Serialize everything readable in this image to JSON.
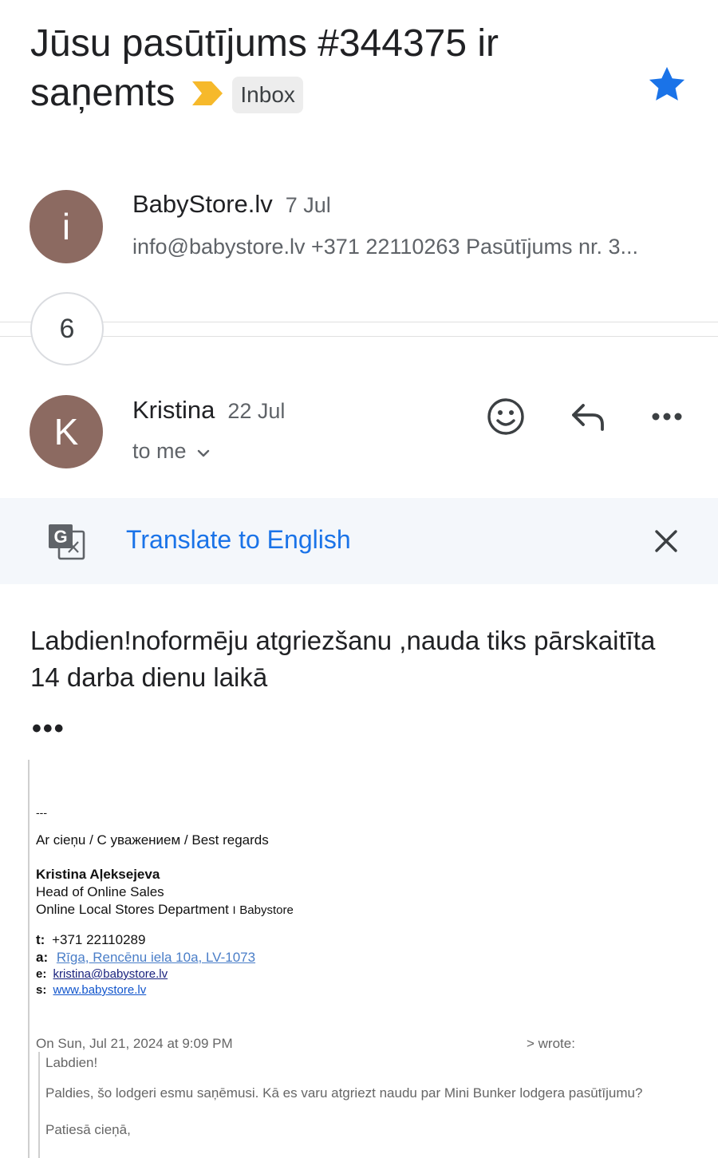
{
  "subject": {
    "text": "Jūsu pasūtījums #344375 ir saņemts",
    "label": "Inbox"
  },
  "colors": {
    "avatar": "#8c6a61",
    "star": "#1a73e8",
    "label_marker": "#f6b92b",
    "link": "#1a73e8",
    "translate_bg": "#f4f7fb"
  },
  "collapsed_message": {
    "avatar_letter": "i",
    "sender": "BabyStore.lv",
    "date": "7 Jul",
    "snippet": "info@babystore.lv +371 22110263 Pasūtījums nr. 3..."
  },
  "hidden_count": "6",
  "open_message": {
    "avatar_letter": "K",
    "sender": "Kristina",
    "date": "22 Jul",
    "recipient": "to me",
    "icons": [
      "emoji-icon",
      "reply-icon",
      "more-icon"
    ]
  },
  "translate": {
    "label": "Translate to English"
  },
  "body": {
    "text": "Labdien!noformēju atgriezšanu ,nauda tiks pārskaitīta 14 darba dienu laikā",
    "ellipsis": "•••"
  },
  "signature": {
    "separator": "---",
    "regards": "Ar cieņu / С уважением / Best regards",
    "name": "Kristina Aļeksejeva",
    "title": "Head of Online Sales",
    "department": "Online Local Stores Department",
    "company_sep": "I",
    "company": "Babystore",
    "phone_label": "t:",
    "phone": "+371 22110289",
    "address_label": "a:",
    "address": "Rīga, Rencēnu iela 10a, LV-1073",
    "email_label": "e:",
    "email": "kristina@babystore.lv",
    "site_label": "s:",
    "site": "www.babystore.lv"
  },
  "quote": {
    "header": "On Sun, Jul 21, 2024 at 9:09 PM",
    "wrote": "> wrote:",
    "greeting": "Labdien!",
    "line1": "Paldies, šo lodgeri esmu saņēmusi. Kā es varu atgriezt naudu par Mini Bunker lodgera pasūtījumu?",
    "closing": "Patiesā cieņā,"
  }
}
